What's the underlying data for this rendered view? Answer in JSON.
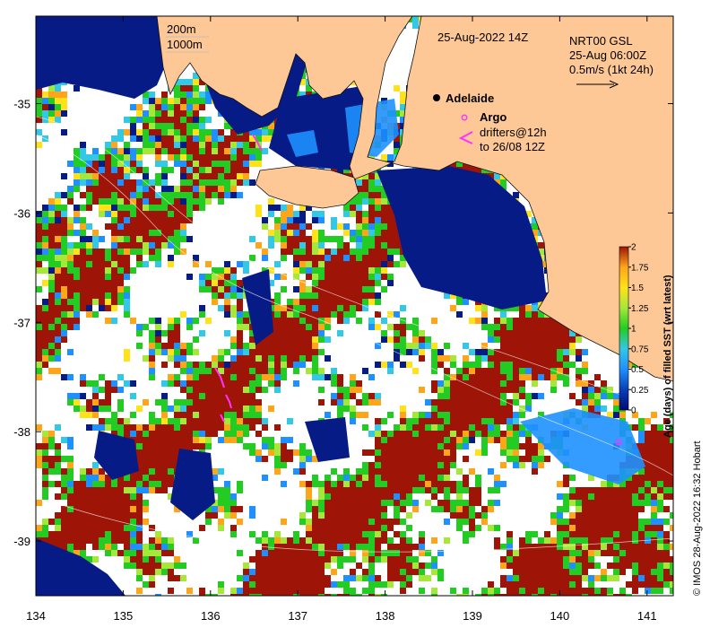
{
  "map": {
    "title": "25-Aug-2022 14Z",
    "product": {
      "line1": "NRT00 GSL",
      "line2": "25-Aug 06:00Z",
      "line3": "0.5m/s (1kt 24h)"
    },
    "contour_legend": [
      "200m",
      "1000m"
    ],
    "city": "Adelaide",
    "legend": {
      "argo": "Argo",
      "drifters_line1": "drifters@12h",
      "drifters_line2": "to 26/08 12Z"
    },
    "x_ticks": [
      "134",
      "135",
      "136",
      "137",
      "138",
      "139",
      "140",
      "141"
    ],
    "y_ticks": [
      "-35",
      "-36",
      "-37",
      "-38",
      "-39"
    ],
    "x_tick_values": [
      134,
      135,
      136,
      137,
      138,
      139,
      140,
      141
    ],
    "y_tick_values": [
      -35,
      -36,
      -37,
      -38,
      -39
    ],
    "lon_range": [
      134,
      141.3
    ],
    "lat_range": [
      -39.5,
      -34.2
    ],
    "colorbar": {
      "title": "Age (days) of filled SST (wrt latest)",
      "ticks": [
        "0",
        "0.25",
        "0.5",
        "0.75",
        "1",
        "1.25",
        "1.5",
        "1.75",
        "2"
      ],
      "range": [
        0,
        2
      ],
      "colors": [
        "#000a7a",
        "#0a3fb5",
        "#1e90ff",
        "#33c8e6",
        "#22cc22",
        "#a6e83a",
        "#ffe21a",
        "#ffa51a",
        "#9e1508"
      ]
    },
    "credit": "© IMOS 28-Aug-2022 16:32 Hobart",
    "colors": {
      "land": "#fdc896",
      "no_data": "#ffffff",
      "argo": "#ff33ff",
      "drifter": "#ff33ff",
      "city": "#000000"
    }
  }
}
